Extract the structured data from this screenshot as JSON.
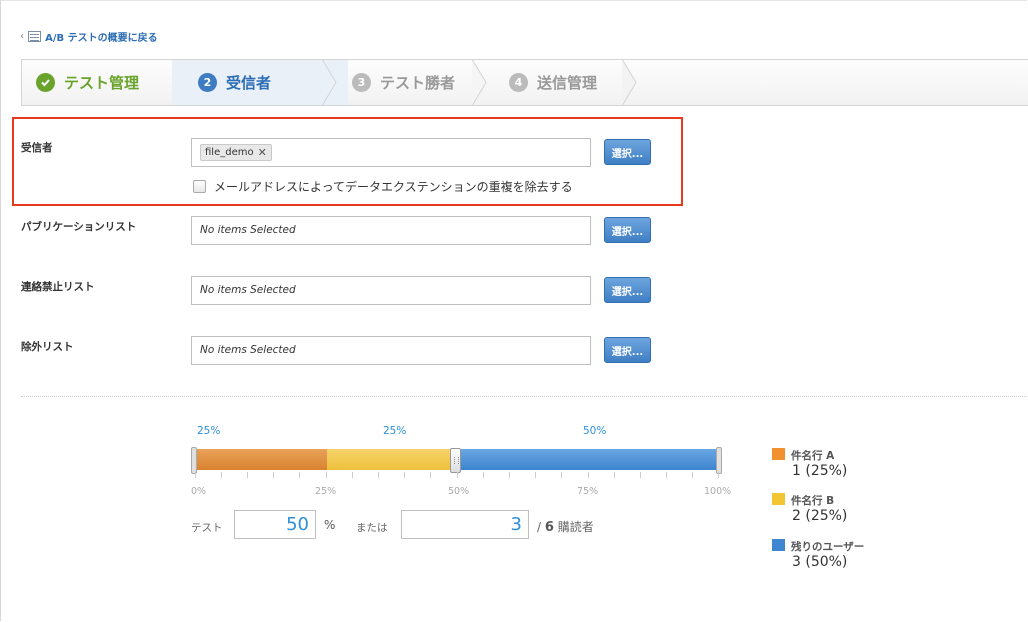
{
  "back_link": {
    "label": "A/B テストの概要に戻る"
  },
  "steps": [
    {
      "num": "",
      "label": "テスト管理",
      "state": "done"
    },
    {
      "num": "2",
      "label": "受信者",
      "state": "active"
    },
    {
      "num": "3",
      "label": "テスト勝者",
      "state": "pending"
    },
    {
      "num": "4",
      "label": "送信管理",
      "state": "pending"
    }
  ],
  "recipients": {
    "label": "受信者",
    "tag": "file_demo",
    "tag_remove": "✕",
    "dedupe_label": "メールアドレスによってデータエクステンションの重複を除去する",
    "dedupe_checked": false,
    "button": "選択..."
  },
  "publication_list": {
    "label": "パブリケーションリスト",
    "value": "No items Selected",
    "button": "選択..."
  },
  "suppression_list": {
    "label": "連絡禁止リスト",
    "value": "No items Selected",
    "button": "選択..."
  },
  "exclusion_list": {
    "label": "除外リスト",
    "value": "No items Selected",
    "button": "選択..."
  },
  "split": {
    "segment_labels": [
      "25%",
      "25%",
      "50%"
    ],
    "scale": [
      "0%",
      "25%",
      "50%",
      "75%",
      "100%"
    ],
    "colors": {
      "a": "#e08e3c",
      "b": "#f2c63f",
      "rest": "#3f86d0"
    },
    "test_label": "テスト",
    "test_value": "50",
    "percent_sign": "%",
    "or_label": "または",
    "count_value": "3",
    "total_prefix": "/",
    "total_count": "6",
    "total_suffix": "購読者"
  },
  "legend": [
    {
      "name": "件名行 A",
      "value": "1 (25%)",
      "color": "#f0902e"
    },
    {
      "name": "件名行 B",
      "value": "2 (25%)",
      "color": "#f2c533"
    },
    {
      "name": "残りのユーザー",
      "value": "3 (50%)",
      "color": "#3f86d0"
    }
  ]
}
